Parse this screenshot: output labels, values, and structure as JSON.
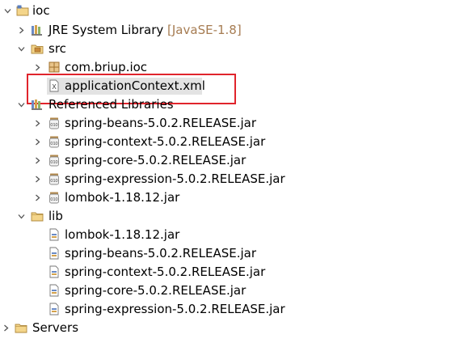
{
  "tree": {
    "project": "ioc",
    "jre": {
      "label": "JRE System Library",
      "decoration": "[JavaSE-1.8]"
    },
    "src": {
      "label": "src",
      "package": "com.briup.ioc",
      "file": "applicationContext.xml"
    },
    "referenced_libraries": {
      "label": "Referenced Libraries",
      "items": [
        "spring-beans-5.0.2.RELEASE.jar",
        "spring-context-5.0.2.RELEASE.jar",
        "spring-core-5.0.2.RELEASE.jar",
        "spring-expression-5.0.2.RELEASE.jar",
        "lombok-1.18.12.jar"
      ]
    },
    "lib": {
      "label": "lib",
      "items": [
        "lombok-1.18.12.jar",
        "spring-beans-5.0.2.RELEASE.jar",
        "spring-context-5.0.2.RELEASE.jar",
        "spring-core-5.0.2.RELEASE.jar",
        "spring-expression-5.0.2.RELEASE.jar"
      ]
    },
    "servers": "Servers"
  },
  "colors": {
    "highlight_box": "#e0242c",
    "selection": "#e3e3e3",
    "decoration_text": "#a67c52"
  },
  "icons": {
    "project": "project-folder-icon",
    "jre": "library-icon",
    "src": "source-folder-icon",
    "package": "package-icon",
    "xml": "xml-file-icon",
    "referenced_libraries": "library-icon",
    "jar": "jar-icon",
    "lib_folder": "folder-icon",
    "lib_jar": "jar-file-icon",
    "servers": "folder-icon"
  }
}
